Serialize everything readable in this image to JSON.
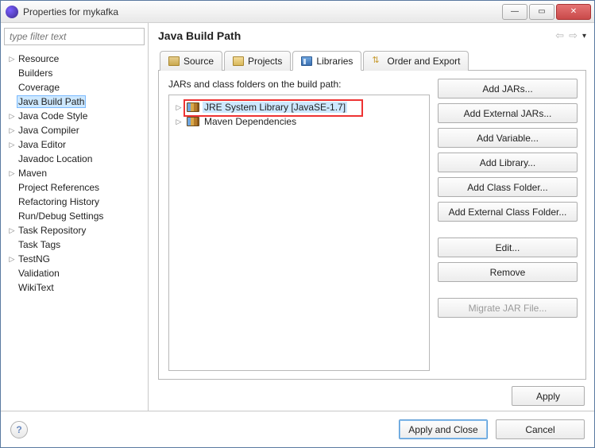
{
  "window": {
    "title": "Properties for mykafka"
  },
  "filter": {
    "placeholder": "type filter text"
  },
  "sidebar": {
    "items": [
      {
        "label": "Resource",
        "expandable": true
      },
      {
        "label": "Builders",
        "expandable": false
      },
      {
        "label": "Coverage",
        "expandable": false
      },
      {
        "label": "Java Build Path",
        "expandable": false,
        "selected": true
      },
      {
        "label": "Java Code Style",
        "expandable": true
      },
      {
        "label": "Java Compiler",
        "expandable": true
      },
      {
        "label": "Java Editor",
        "expandable": true
      },
      {
        "label": "Javadoc Location",
        "expandable": false
      },
      {
        "label": "Maven",
        "expandable": true
      },
      {
        "label": "Project References",
        "expandable": false
      },
      {
        "label": "Refactoring History",
        "expandable": false
      },
      {
        "label": "Run/Debug Settings",
        "expandable": false
      },
      {
        "label": "Task Repository",
        "expandable": true
      },
      {
        "label": "Task Tags",
        "expandable": false
      },
      {
        "label": "TestNG",
        "expandable": true
      },
      {
        "label": "Validation",
        "expandable": false
      },
      {
        "label": "WikiText",
        "expandable": false
      }
    ]
  },
  "page": {
    "title": "Java Build Path",
    "tabs": [
      {
        "label": "Source",
        "icon": "src"
      },
      {
        "label": "Projects",
        "icon": "proj"
      },
      {
        "label": "Libraries",
        "icon": "lib",
        "active": true
      },
      {
        "label": "Order and Export",
        "icon": "order"
      }
    ],
    "lib_caption": "JARs and class folders on the build path:",
    "entries": [
      {
        "label": "JRE System Library [JavaSE-1.7]",
        "selected": true,
        "highlight": true
      },
      {
        "label": "Maven Dependencies",
        "selected": false
      }
    ],
    "buttons": {
      "add_jars": "Add JARs...",
      "add_ext_jars": "Add External JARs...",
      "add_var": "Add Variable...",
      "add_lib": "Add Library...",
      "add_cf": "Add Class Folder...",
      "add_ext_cf": "Add External Class Folder...",
      "edit": "Edit...",
      "remove": "Remove",
      "migrate": "Migrate JAR File...",
      "apply": "Apply"
    }
  },
  "footer": {
    "apply_close": "Apply and Close",
    "cancel": "Cancel"
  }
}
